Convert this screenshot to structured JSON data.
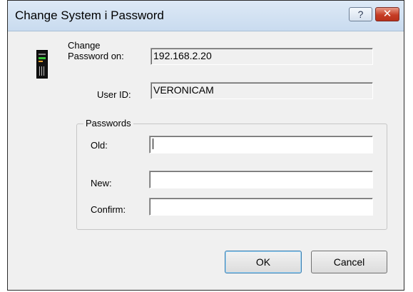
{
  "window": {
    "title": "Change System i Password",
    "help_glyph": "?",
    "close_glyph": "✕"
  },
  "system": {
    "change_label_line1": "Change",
    "change_label_line2": "Password on:",
    "host_value": "192.168.2.20",
    "user_label": "User ID:",
    "user_value": "VERONICAM"
  },
  "passwords": {
    "group_label": "Passwords",
    "old_label": "Old:",
    "new_label": "New:",
    "confirm_label": "Confirm:",
    "old_value": "",
    "new_value": "",
    "confirm_value": ""
  },
  "buttons": {
    "ok_label": "OK",
    "cancel_label": "Cancel"
  },
  "icons": {
    "device": "system-i-server-icon",
    "help": "help-icon",
    "close": "close-icon"
  },
  "colors": {
    "dialog_bg": "#f0f0f0",
    "close_button": "#c63d25",
    "default_button_border": "#3c7fb1"
  }
}
